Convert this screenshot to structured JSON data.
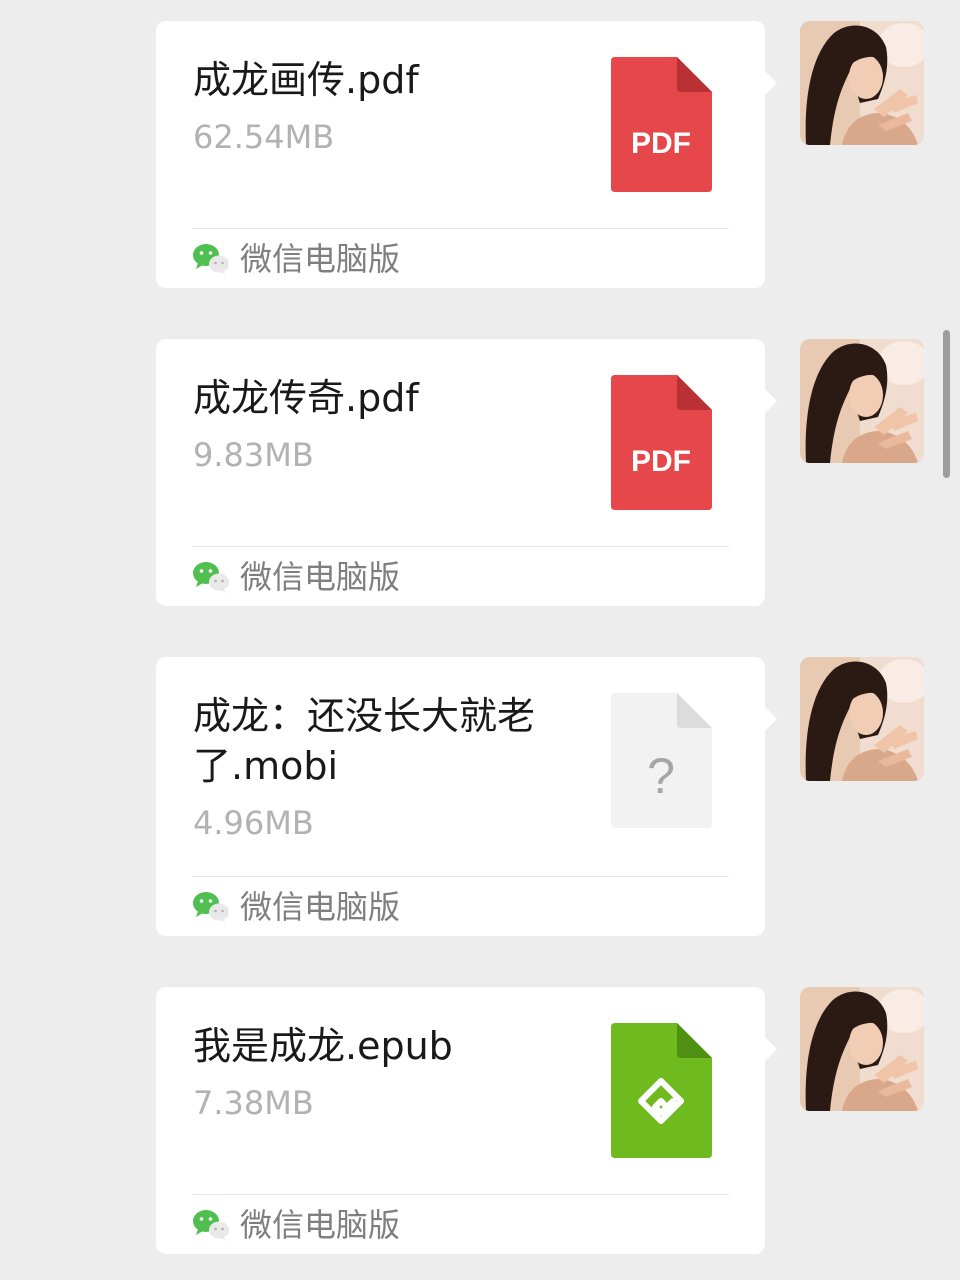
{
  "messages": [
    {
      "file_name": "成龙画传.pdf",
      "file_size": "62.54MB",
      "file_type": "pdf",
      "icon_label": "PDF",
      "icon": "pdf-file-icon",
      "source": "微信电脑版"
    },
    {
      "file_name": "成龙传奇.pdf",
      "file_size": "9.83MB",
      "file_type": "pdf",
      "icon_label": "PDF",
      "icon": "pdf-file-icon",
      "source": "微信电脑版"
    },
    {
      "file_name": "成龙：还没长大就老了.mobi",
      "file_size": "4.96MB",
      "file_type": "unknown",
      "icon_label": "?",
      "icon": "unknown-file-icon",
      "source": "微信电脑版"
    },
    {
      "file_name": "我是成龙.epub",
      "file_size": "7.38MB",
      "file_type": "epub",
      "icon_label": "",
      "icon": "epub-file-icon",
      "source": "微信电脑版"
    }
  ],
  "colors": {
    "pdf": "#e6474a",
    "pdf_fold": "#b93135",
    "epub": "#6fba1f",
    "epub_fold": "#4f8f12",
    "unknown": "#f2f2f2",
    "unknown_fold": "#dcdcdc",
    "background": "#ededed",
    "bubble": "#ffffff"
  }
}
